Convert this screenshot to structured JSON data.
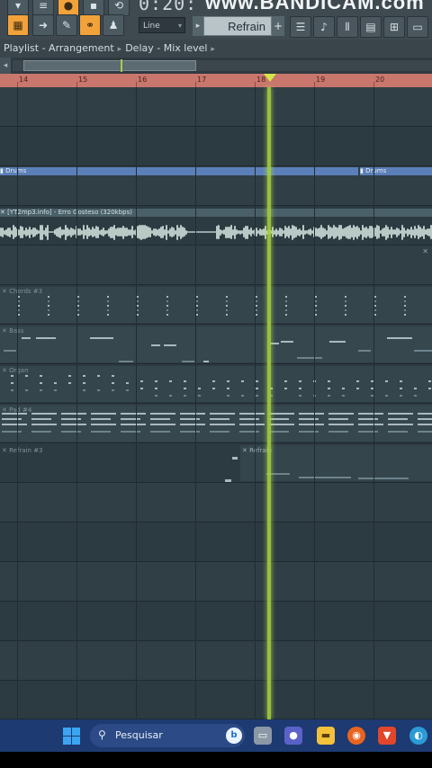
{
  "toolbar": {
    "time": "0:20:",
    "watermark": "www.BANDICAM.com",
    "snap_value": "Line",
    "pattern_name": "Refrain",
    "pattern_plus": "+",
    "icons": [
      "pattern-song-icon",
      "arrow-icon",
      "pencil-icon",
      "link-icon",
      "stamp-icon",
      "playlist-icon",
      "piano-roll-icon",
      "mixer-icon",
      "browser-icon",
      "plugin-icon"
    ]
  },
  "window": {
    "title_parts": [
      "Playlist - Arrangement",
      "Delay - Mix level"
    ]
  },
  "ruler": {
    "bars": [
      "14",
      "15",
      "16",
      "17",
      "18",
      "19",
      "20"
    ],
    "color": "#c9766c"
  },
  "tracks": {
    "drums_label": "Drums",
    "drums_label_2": "Drums",
    "audio_label": "[YT2mp3.info] - Erro Gosteso (320kbps)",
    "chords_label": "Chords #3",
    "bass_label": "Bass",
    "organ_label": "Organ",
    "pad_label": "Pad #4",
    "refrain_label": "Refrain #3",
    "refrain_label_2": "Refrain"
  },
  "taskbar": {
    "search_placeholder": "Pesquisar",
    "bing_letter": "b",
    "apps": [
      "task-view-icon",
      "meet-icon",
      "file-explorer-icon",
      "firefox-icon",
      "brave-icon",
      "edge-icon"
    ]
  },
  "colors": {
    "playhead": "#a2cf3c",
    "accent_orange": "#f2a23a",
    "drums_clip": "#5b7fb8",
    "taskbar": "#1e3a72"
  }
}
